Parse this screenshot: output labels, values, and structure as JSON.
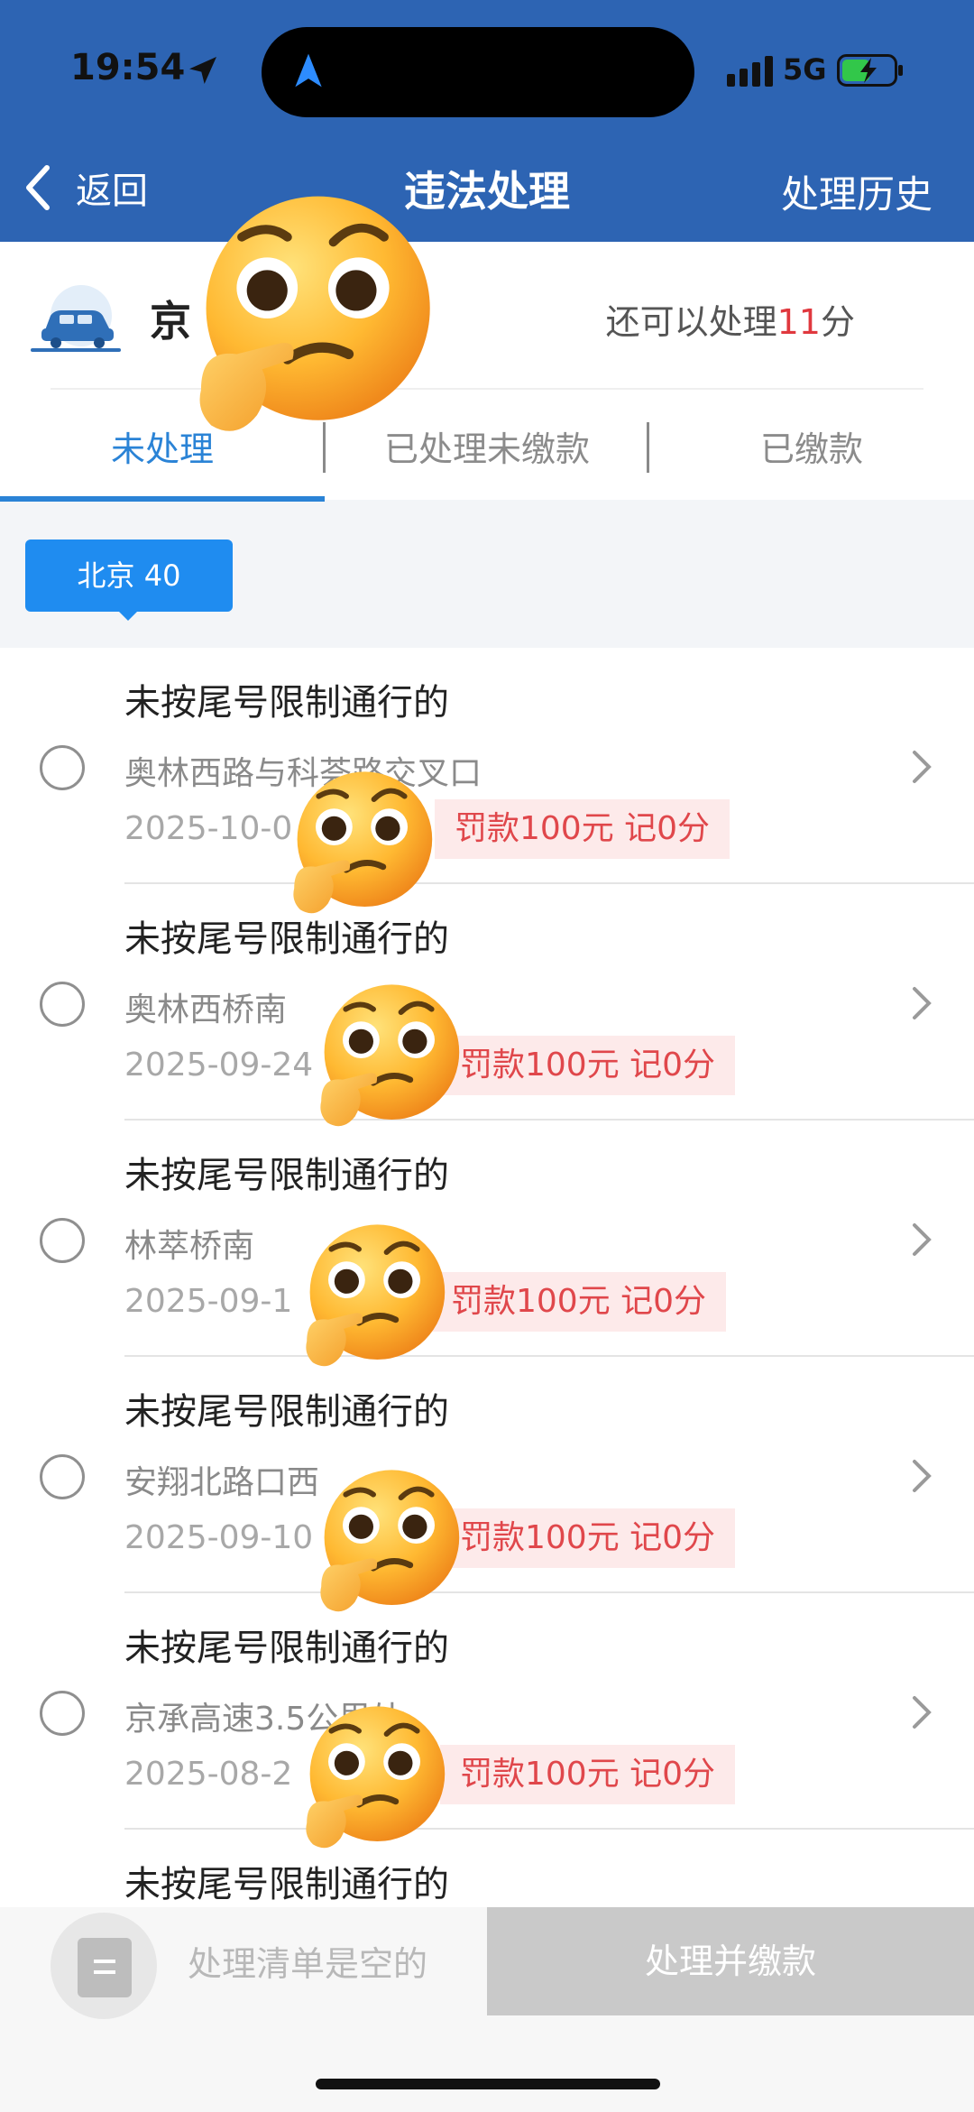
{
  "status_bar": {
    "time": "19:54",
    "network": "5G"
  },
  "nav": {
    "back_label": "返回",
    "title": "违法处理",
    "history_label": "处理历史"
  },
  "vehicle": {
    "plate_visible": "京",
    "points_prefix": "还可以处理",
    "points_value": "11",
    "points_suffix": "分"
  },
  "tabs": [
    {
      "label": "未处理",
      "active": true
    },
    {
      "label": "已处理未缴款",
      "active": false
    },
    {
      "label": "已缴款",
      "active": false
    }
  ],
  "region_chip": {
    "label": "北京 40"
  },
  "violations": [
    {
      "title": "未按尾号限制通行的",
      "location": "奥林西路与科荟路交叉口",
      "date": "2025-10-0",
      "fine": "罚款100元  记0分"
    },
    {
      "title": "未按尾号限制通行的",
      "location": "奥林西桥南",
      "date": "2025-09-24",
      "fine": "罚款100元  记0分"
    },
    {
      "title": "未按尾号限制通行的",
      "location": "林萃桥南",
      "date": "2025-09-1",
      "fine": "罚款100元  记0分"
    },
    {
      "title": "未按尾号限制通行的",
      "location": "安翔北路口西",
      "date": "2025-09-10",
      "fine": "罚款100元  记0分"
    },
    {
      "title": "未按尾号限制通行的",
      "location": "京承高速3.5公里处",
      "date": "2025-08-2",
      "fine": "罚款100元  记0分"
    },
    {
      "title": "未按尾号限制通行的"
    }
  ],
  "bottom_bar": {
    "empty_text": "处理清单是空的",
    "submit_label": "处理并缴款"
  },
  "colors": {
    "header_blue": "#2d64b3",
    "tab_active": "#2a83d6",
    "chip_blue": "#1f8cf0",
    "fine_red": "#e0474b",
    "points_red": "#e0383e"
  },
  "icons": [
    "location-arrow-icon",
    "signal-icon",
    "battery-charging-icon",
    "back-chevron-icon",
    "car-icon",
    "chevron-right-icon",
    "list-doc-icon",
    "thinking-face-emoji"
  ]
}
